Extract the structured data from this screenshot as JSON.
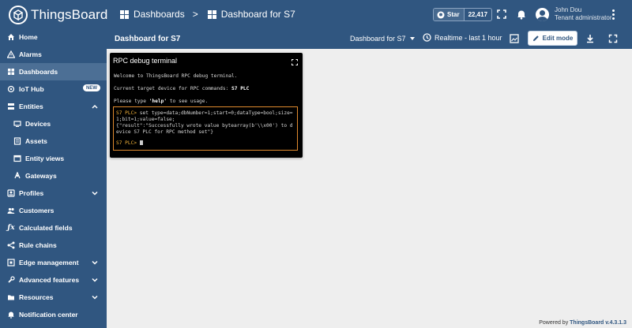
{
  "app": {
    "name": "ThingsBoard"
  },
  "breadcrumbs": {
    "dashboards": "Dashboards",
    "current": "Dashboard for S7"
  },
  "github": {
    "star_label": "Star",
    "count": "22,417"
  },
  "user": {
    "name": "John Dou",
    "role": "Tenant administrator"
  },
  "sidebar": {
    "items": [
      {
        "label": "Home"
      },
      {
        "label": "Alarms"
      },
      {
        "label": "Dashboards"
      },
      {
        "label": "IoT Hub",
        "badge": "NEW"
      },
      {
        "label": "Entities"
      },
      {
        "label": "Devices"
      },
      {
        "label": "Assets"
      },
      {
        "label": "Entity views"
      },
      {
        "label": "Gateways"
      },
      {
        "label": "Profiles"
      },
      {
        "label": "Customers"
      },
      {
        "label": "Calculated fields"
      },
      {
        "label": "Rule chains"
      },
      {
        "label": "Edge management"
      },
      {
        "label": "Advanced features"
      },
      {
        "label": "Resources"
      },
      {
        "label": "Notification center"
      }
    ]
  },
  "dashboard": {
    "title": "Dashboard for S7",
    "state_select": "Dashboard for S7",
    "timewindow": "Realtime - last 1 hour",
    "edit_label": "Edit mode"
  },
  "widget": {
    "title": "RPC debug terminal",
    "welcome": "Welcome to ThingsBoard RPC debug terminal.",
    "target_prefix": "Current target device for RPC commands: ",
    "target_device": "S7 PLC",
    "usage_prefix": "Please type ",
    "usage_keyword": "'help'",
    "usage_suffix": " to see usage.",
    "prompt": "S7 PLC>",
    "command": " set type=data;dbNumber=1;start=0;dataType=bool;size=1;bit=1;value=false;",
    "result": "{\"result\":\"Successfully wrote value bytearray(b'\\\\x00') to device S7 PLC for RPC method set\"}",
    "prompt2": "S7 PLC>"
  },
  "footer": {
    "prefix": "Powered by ",
    "brand": "ThingsBoard",
    "version": " v.4.3.1.3"
  },
  "colors": {
    "primary": "#305680",
    "active": "#4c6f95",
    "prompt": "#f2b23a",
    "box_border": "#e08a2e"
  }
}
